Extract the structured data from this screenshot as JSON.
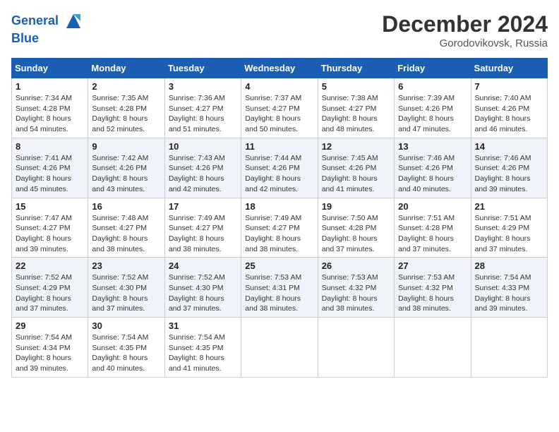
{
  "header": {
    "logo_line1": "General",
    "logo_line2": "Blue",
    "month_title": "December 2024",
    "location": "Gorodovikovsk, Russia"
  },
  "days_of_week": [
    "Sunday",
    "Monday",
    "Tuesday",
    "Wednesday",
    "Thursday",
    "Friday",
    "Saturday"
  ],
  "weeks": [
    [
      {
        "day": "1",
        "sunrise": "7:34 AM",
        "sunset": "4:28 PM",
        "daylight": "8 hours and 54 minutes."
      },
      {
        "day": "2",
        "sunrise": "7:35 AM",
        "sunset": "4:28 PM",
        "daylight": "8 hours and 52 minutes."
      },
      {
        "day": "3",
        "sunrise": "7:36 AM",
        "sunset": "4:27 PM",
        "daylight": "8 hours and 51 minutes."
      },
      {
        "day": "4",
        "sunrise": "7:37 AM",
        "sunset": "4:27 PM",
        "daylight": "8 hours and 50 minutes."
      },
      {
        "day": "5",
        "sunrise": "7:38 AM",
        "sunset": "4:27 PM",
        "daylight": "8 hours and 48 minutes."
      },
      {
        "day": "6",
        "sunrise": "7:39 AM",
        "sunset": "4:26 PM",
        "daylight": "8 hours and 47 minutes."
      },
      {
        "day": "7",
        "sunrise": "7:40 AM",
        "sunset": "4:26 PM",
        "daylight": "8 hours and 46 minutes."
      }
    ],
    [
      {
        "day": "8",
        "sunrise": "7:41 AM",
        "sunset": "4:26 PM",
        "daylight": "8 hours and 45 minutes."
      },
      {
        "day": "9",
        "sunrise": "7:42 AM",
        "sunset": "4:26 PM",
        "daylight": "8 hours and 43 minutes."
      },
      {
        "day": "10",
        "sunrise": "7:43 AM",
        "sunset": "4:26 PM",
        "daylight": "8 hours and 42 minutes."
      },
      {
        "day": "11",
        "sunrise": "7:44 AM",
        "sunset": "4:26 PM",
        "daylight": "8 hours and 42 minutes."
      },
      {
        "day": "12",
        "sunrise": "7:45 AM",
        "sunset": "4:26 PM",
        "daylight": "8 hours and 41 minutes."
      },
      {
        "day": "13",
        "sunrise": "7:46 AM",
        "sunset": "4:26 PM",
        "daylight": "8 hours and 40 minutes."
      },
      {
        "day": "14",
        "sunrise": "7:46 AM",
        "sunset": "4:26 PM",
        "daylight": "8 hours and 39 minutes."
      }
    ],
    [
      {
        "day": "15",
        "sunrise": "7:47 AM",
        "sunset": "4:27 PM",
        "daylight": "8 hours and 39 minutes."
      },
      {
        "day": "16",
        "sunrise": "7:48 AM",
        "sunset": "4:27 PM",
        "daylight": "8 hours and 38 minutes."
      },
      {
        "day": "17",
        "sunrise": "7:49 AM",
        "sunset": "4:27 PM",
        "daylight": "8 hours and 38 minutes."
      },
      {
        "day": "18",
        "sunrise": "7:49 AM",
        "sunset": "4:27 PM",
        "daylight": "8 hours and 38 minutes."
      },
      {
        "day": "19",
        "sunrise": "7:50 AM",
        "sunset": "4:28 PM",
        "daylight": "8 hours and 37 minutes."
      },
      {
        "day": "20",
        "sunrise": "7:51 AM",
        "sunset": "4:28 PM",
        "daylight": "8 hours and 37 minutes."
      },
      {
        "day": "21",
        "sunrise": "7:51 AM",
        "sunset": "4:29 PM",
        "daylight": "8 hours and 37 minutes."
      }
    ],
    [
      {
        "day": "22",
        "sunrise": "7:52 AM",
        "sunset": "4:29 PM",
        "daylight": "8 hours and 37 minutes."
      },
      {
        "day": "23",
        "sunrise": "7:52 AM",
        "sunset": "4:30 PM",
        "daylight": "8 hours and 37 minutes."
      },
      {
        "day": "24",
        "sunrise": "7:52 AM",
        "sunset": "4:30 PM",
        "daylight": "8 hours and 37 minutes."
      },
      {
        "day": "25",
        "sunrise": "7:53 AM",
        "sunset": "4:31 PM",
        "daylight": "8 hours and 38 minutes."
      },
      {
        "day": "26",
        "sunrise": "7:53 AM",
        "sunset": "4:32 PM",
        "daylight": "8 hours and 38 minutes."
      },
      {
        "day": "27",
        "sunrise": "7:53 AM",
        "sunset": "4:32 PM",
        "daylight": "8 hours and 38 minutes."
      },
      {
        "day": "28",
        "sunrise": "7:54 AM",
        "sunset": "4:33 PM",
        "daylight": "8 hours and 39 minutes."
      }
    ],
    [
      {
        "day": "29",
        "sunrise": "7:54 AM",
        "sunset": "4:34 PM",
        "daylight": "8 hours and 39 minutes."
      },
      {
        "day": "30",
        "sunrise": "7:54 AM",
        "sunset": "4:35 PM",
        "daylight": "8 hours and 40 minutes."
      },
      {
        "day": "31",
        "sunrise": "7:54 AM",
        "sunset": "4:35 PM",
        "daylight": "8 hours and 41 minutes."
      },
      null,
      null,
      null,
      null
    ]
  ],
  "labels": {
    "sunrise": "Sunrise:",
    "sunset": "Sunset:",
    "daylight": "Daylight:"
  }
}
